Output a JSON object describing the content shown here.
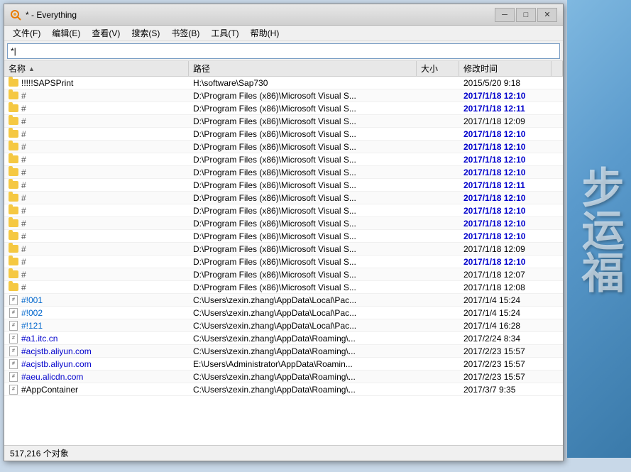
{
  "window": {
    "title": "* - Everything",
    "icon": "🔍"
  },
  "title_bar": {
    "minimize_label": "─",
    "maximize_label": "□",
    "close_label": "✕"
  },
  "menu_bar": {
    "items": [
      {
        "id": "file",
        "label": "文件(F)"
      },
      {
        "id": "edit",
        "label": "编辑(E)"
      },
      {
        "id": "view",
        "label": "查看(V)"
      },
      {
        "id": "search",
        "label": "搜索(S)"
      },
      {
        "id": "bookmark",
        "label": "书签(B)"
      },
      {
        "id": "tools",
        "label": "工具(T)"
      },
      {
        "id": "help",
        "label": "帮助(H)"
      }
    ]
  },
  "search": {
    "value": "*|",
    "placeholder": ""
  },
  "table": {
    "columns": [
      {
        "id": "name",
        "label": "名称",
        "sort": "asc"
      },
      {
        "id": "path",
        "label": "路径"
      },
      {
        "id": "size",
        "label": "大小"
      },
      {
        "id": "modified",
        "label": "修改时间"
      }
    ],
    "rows": [
      {
        "name": "!!!!!SAPSPrint",
        "type": "folder",
        "path": "H:\\software\\Sap730",
        "size": "",
        "modified": "2015/5/20 9:18"
      },
      {
        "name": "#",
        "type": "folder",
        "path": "D:\\Program Files (x86)\\Microsoft Visual S...",
        "size": "",
        "modified": "2017/1/18 12:10"
      },
      {
        "name": "#",
        "type": "folder",
        "path": "D:\\Program Files (x86)\\Microsoft Visual S...",
        "size": "",
        "modified": "2017/1/18 12:11"
      },
      {
        "name": "#",
        "type": "folder",
        "path": "D:\\Program Files (x86)\\Microsoft Visual S...",
        "size": "",
        "modified": "2017/1/18 12:09"
      },
      {
        "name": "#",
        "type": "folder",
        "path": "D:\\Program Files (x86)\\Microsoft Visual S...",
        "size": "",
        "modified": "2017/1/18 12:10"
      },
      {
        "name": "#",
        "type": "folder",
        "path": "D:\\Program Files (x86)\\Microsoft Visual S...",
        "size": "",
        "modified": "2017/1/18 12:10"
      },
      {
        "name": "#",
        "type": "folder",
        "path": "D:\\Program Files (x86)\\Microsoft Visual S...",
        "size": "",
        "modified": "2017/1/18 12:10"
      },
      {
        "name": "#",
        "type": "folder",
        "path": "D:\\Program Files (x86)\\Microsoft Visual S...",
        "size": "",
        "modified": "2017/1/18 12:10"
      },
      {
        "name": "#",
        "type": "folder",
        "path": "D:\\Program Files (x86)\\Microsoft Visual S...",
        "size": "",
        "modified": "2017/1/18 12:11"
      },
      {
        "name": "#",
        "type": "folder",
        "path": "D:\\Program Files (x86)\\Microsoft Visual S...",
        "size": "",
        "modified": "2017/1/18 12:10"
      },
      {
        "name": "#",
        "type": "folder",
        "path": "D:\\Program Files (x86)\\Microsoft Visual S...",
        "size": "",
        "modified": "2017/1/18 12:10"
      },
      {
        "name": "#",
        "type": "folder",
        "path": "D:\\Program Files (x86)\\Microsoft Visual S...",
        "size": "",
        "modified": "2017/1/18 12:10"
      },
      {
        "name": "#",
        "type": "folder",
        "path": "D:\\Program Files (x86)\\Microsoft Visual S...",
        "size": "",
        "modified": "2017/1/18 12:10"
      },
      {
        "name": "#",
        "type": "folder",
        "path": "D:\\Program Files (x86)\\Microsoft Visual S...",
        "size": "",
        "modified": "2017/1/18 12:09"
      },
      {
        "name": "#",
        "type": "folder",
        "path": "D:\\Program Files (x86)\\Microsoft Visual S...",
        "size": "",
        "modified": "2017/1/18 12:10"
      },
      {
        "name": "#",
        "type": "folder",
        "path": "D:\\Program Files (x86)\\Microsoft Visual S...",
        "size": "",
        "modified": "2017/1/18 12:07"
      },
      {
        "name": "#",
        "type": "folder",
        "path": "D:\\Program Files (x86)\\Microsoft Visual S...",
        "size": "",
        "modified": "2017/1/18 12:08"
      },
      {
        "name": "#!001",
        "type": "file",
        "path": "C:\\Users\\zexin.zhang\\AppData\\Local\\Pac...",
        "size": "",
        "modified": "2017/1/4 15:24"
      },
      {
        "name": "#!002",
        "type": "file",
        "path": "C:\\Users\\zexin.zhang\\AppData\\Local\\Pac...",
        "size": "",
        "modified": "2017/1/4 15:24"
      },
      {
        "name": "#!121",
        "type": "file",
        "path": "C:\\Users\\zexin.zhang\\AppData\\Local\\Pac...",
        "size": "",
        "modified": "2017/1/4 16:28"
      },
      {
        "name": "#a1.itc.cn",
        "type": "file",
        "path": "C:\\Users\\zexin.zhang\\AppData\\Roaming\\...",
        "size": "",
        "modified": "2017/2/24 8:34"
      },
      {
        "name": "#acjstb.aliyun.com",
        "type": "file",
        "path": "C:\\Users\\zexin.zhang\\AppData\\Roaming\\...",
        "size": "",
        "modified": "2017/2/23 15:57"
      },
      {
        "name": "#acjstb.aliyun.com",
        "type": "file",
        "path": "E:\\Users\\Administrator\\AppData\\Roamin...",
        "size": "",
        "modified": "2017/2/23 15:57"
      },
      {
        "name": "#aeu.alicdn.com",
        "type": "file",
        "path": "C:\\Users\\zexin.zhang\\AppData\\Roaming\\...",
        "size": "",
        "modified": "2017/2/23 15:57"
      },
      {
        "name": "#AppContainer",
        "type": "file",
        "path": "C:\\Users\\zexin.zhang\\AppData\\Roaming\\...",
        "size": "",
        "modified": "2017/3/7 9:35"
      }
    ]
  },
  "status_bar": {
    "text": "517,216 个对象"
  },
  "bg": {
    "chars": "步运福"
  }
}
